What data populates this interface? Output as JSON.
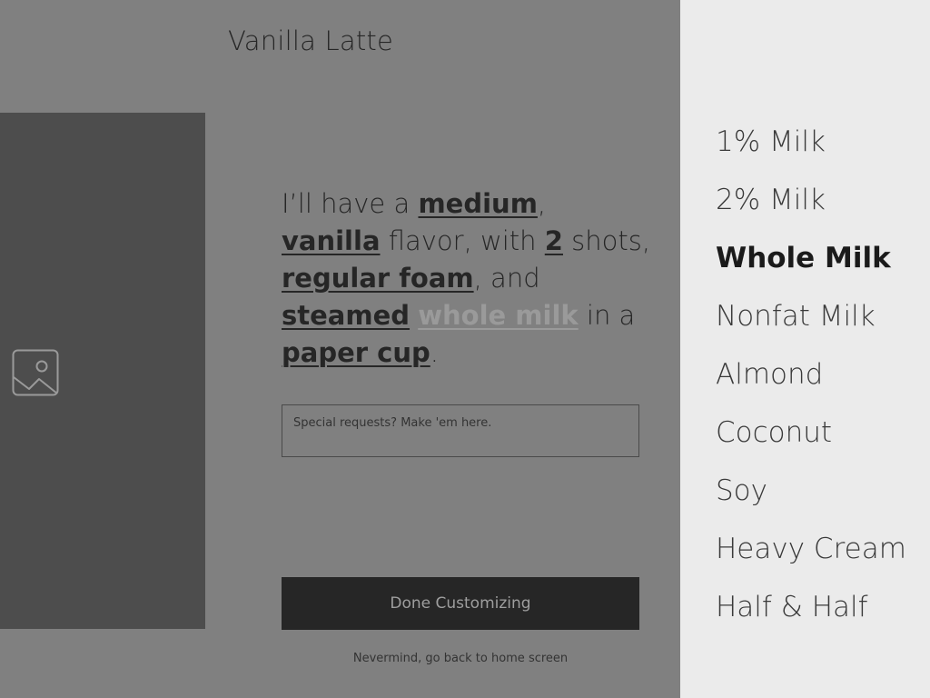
{
  "product": {
    "title": "Vanilla Latte"
  },
  "image_panel": {
    "icon": "image-placeholder-icon"
  },
  "order_sentence": {
    "p1": "I’ll have a ",
    "size": "medium",
    "p2": ",",
    "flavor": "vanilla",
    "p3": " flavor, with ",
    "shots": "2",
    "p4": " shots,",
    "foam": "regular foam",
    "p5": ", and",
    "temperature": "steamed",
    "p6": " ",
    "milk": "whole milk",
    "p7": " in a",
    "cup": "paper cup",
    "p8": "."
  },
  "special_requests": {
    "placeholder": "Special requests? Make 'em here.",
    "value": ""
  },
  "actions": {
    "done_label": "Done Customizing",
    "back_label": "Nevermind, go back to home screen"
  },
  "milk_picker": {
    "options": [
      "1% Milk",
      "2% Milk",
      "Whole Milk",
      "Nonfat Milk",
      "Almond",
      "Coconut",
      "Soy",
      "Heavy Cream",
      "Half & Half"
    ],
    "selected_index": 2
  },
  "colors": {
    "overlay_gray": "#808080",
    "dark_panel": "#4d4d4d",
    "picker_bg": "#ebebeb",
    "button_bg": "#262626"
  }
}
